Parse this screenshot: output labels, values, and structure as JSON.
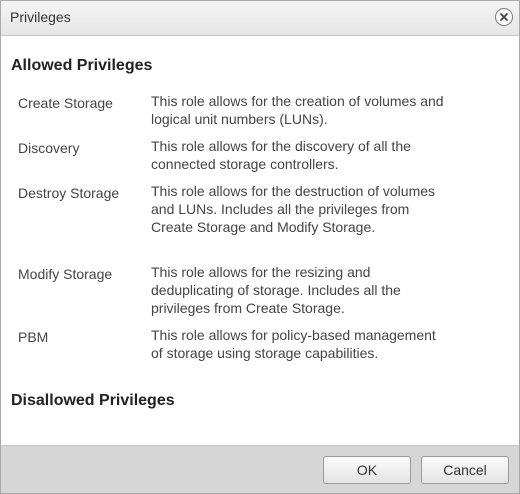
{
  "dialog": {
    "title": "Privileges",
    "close_icon": "close-circle-icon"
  },
  "allowed": {
    "heading": "Allowed Privileges",
    "items": [
      {
        "name": "Create Storage",
        "description": "This role allows for the creation of volumes and logical unit numbers (LUNs)."
      },
      {
        "name": "Discovery",
        "description": "This role allows for the discovery of all the connected storage controllers."
      },
      {
        "name": "Destroy Storage",
        "description": "This role allows for the destruction of volumes and LUNs. Includes all the privileges from Create Storage and Modify Storage."
      },
      {
        "name": "Modify Storage",
        "description": "This role allows for the resizing and deduplicating of storage.  Includes all the privileges from Create Storage."
      },
      {
        "name": "PBM",
        "description": "This role allows for policy-based management of storage using storage capabilities."
      }
    ]
  },
  "disallowed": {
    "heading": "Disallowed Privileges"
  },
  "footer": {
    "ok_label": "OK",
    "cancel_label": "Cancel"
  },
  "colors": {
    "titlebar": "#e9e9e9",
    "footer": "#d6d6d6",
    "text": "#444444"
  }
}
